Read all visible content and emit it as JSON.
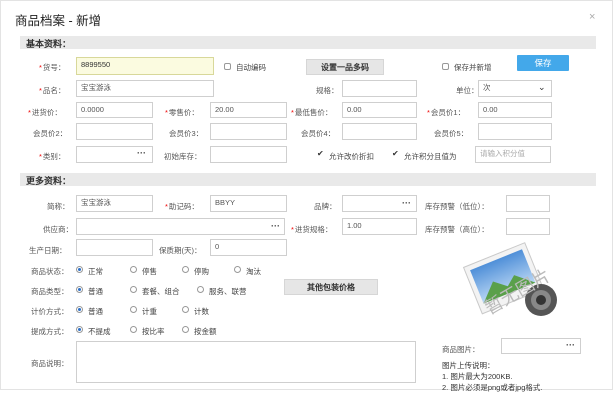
{
  "dialog": {
    "title": "商品档案 - 新增",
    "close_icon": "×"
  },
  "basic": {
    "section_title": "基本资料：",
    "code_label": "货号：",
    "code_value": "8899550",
    "auto_code_label": "自动编码",
    "one_multi_code_btn": "设置一品多码",
    "save_new_label": "保存并新增",
    "save_btn": "保存",
    "name_label": "品名：",
    "name_value": "宝宝游泳",
    "spec_label": "规格：",
    "unit_label": "单位：",
    "unit_value": "次",
    "purchase_price_label": "进货价：",
    "purchase_price_value": "0.0000",
    "retail_price_label": "零售价：",
    "retail_price_value": "20.00",
    "min_price_label": "最低售价：",
    "min_price_value": "0.00",
    "member_price1_label": "会员价1：",
    "member_price1_value": "0.00",
    "member_price2_label": "会员价2：",
    "member_price3_label": "会员价3：",
    "member_price4_label": "会员价4：",
    "member_price5_label": "会员价5：",
    "category_label": "类别：",
    "initial_stock_label": "初始库存：",
    "allow_discount_label": "允许改价折扣",
    "allow_points_label": "允许积分且值为",
    "points_placeholder": "请输入积分值"
  },
  "more": {
    "section_title": "更多资料：",
    "short_name_label": "简称：",
    "short_name_value": "宝宝游泳",
    "mnemonic_label": "助记码：",
    "mnemonic_value": "BBYY",
    "brand_label": "品牌：",
    "stock_warn_low_label": "库存预警（低位）：",
    "supplier_label": "供应商：",
    "purchase_spec_label": "进货规格：",
    "purchase_spec_value": "1.00",
    "stock_warn_high_label": "库存预警（高位）：",
    "production_date_label": "生产日期：",
    "shelf_life_label": "保质期(天)：",
    "shelf_life_value": "0",
    "status_label": "商品状态：",
    "status_options": [
      "正常",
      "停售",
      "停购",
      "淘汰"
    ],
    "type_label": "商品类型：",
    "type_options": [
      "普通",
      "套餐、组合",
      "服务、联营"
    ],
    "other_pack_price_btn": "其他包装价格",
    "pricing_label": "计价方式：",
    "pricing_options": [
      "普通",
      "计重",
      "计数"
    ],
    "commission_label": "提成方式：",
    "commission_options": [
      "不提成",
      "按比率",
      "按金额"
    ],
    "description_label": "商品说明：",
    "image_label": "商品图片：",
    "image_watermark": "暂无图片",
    "upload_title": "图片上传说明：",
    "upload_note1": "1. 图片最大为200KB.",
    "upload_note2": "2. 图片必须是png或者jpg格式."
  }
}
